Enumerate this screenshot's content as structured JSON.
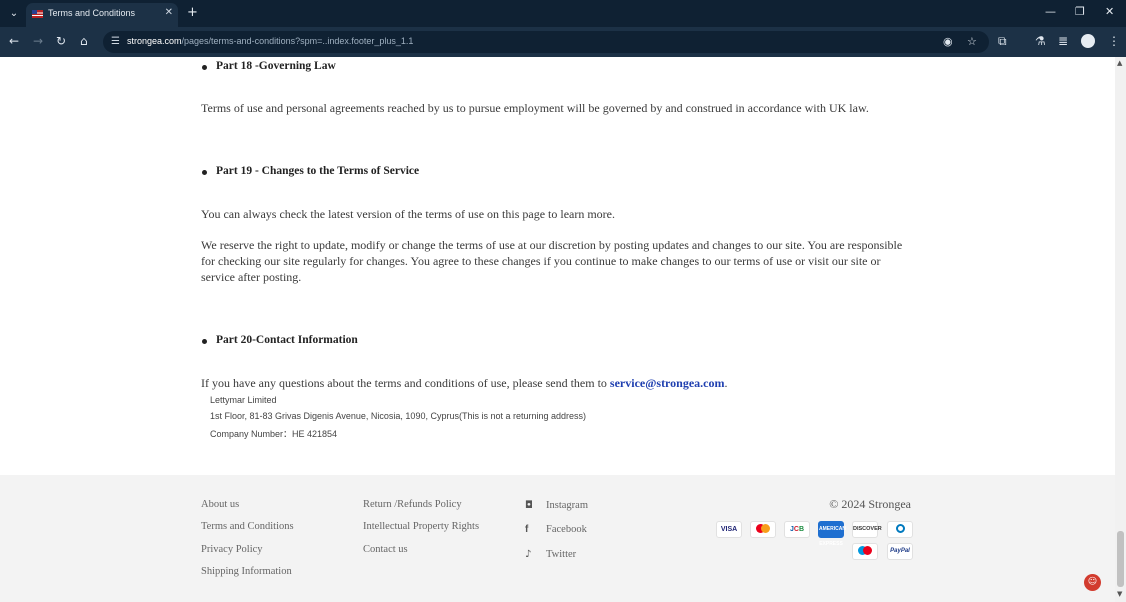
{
  "browser": {
    "tab_title": "Terms and Conditions",
    "url_host": "strongea.com",
    "url_path": "/pages/terms-and-conditions?spm=..index.footer_plus_1.1"
  },
  "content": {
    "part18_heading": "Part 18 -Governing  Law",
    "part18_text": "Terms of use and personal agreements reached by us to pursue employment will be governed by and construed in accordance with UK law.",
    "part19_heading": "Part 19 - Changes to the Terms of Service",
    "part19_text1": "You can always check the latest version of the terms of use on this page to learn more.",
    "part19_text2": "We reserve the right to update, modify or change the terms of use at our discretion by posting updates and changes to our site. You are responsible for checking our site regularly for changes. You agree to these changes if you continue to make changes to our terms of use or visit our site or service after posting.",
    "part20_heading": "Part 20-Contact Information",
    "part20_text": "If you have any questions about the terms and conditions of use, please send them to ",
    "contact_email": "service@strongea.com",
    "contact_email_suffix": ".",
    "company_name": "Lettymar Limited",
    "company_address": "1st Floor, 81-83 Grivas Digenis Avenue, Nicosia, 1090, Cyprus(This is not a returning address)",
    "company_number": "Company Number：HE 421854"
  },
  "footer": {
    "col1": [
      "About us",
      "Terms and Conditions",
      "Privacy Policy",
      "Shipping Information"
    ],
    "col2": [
      "Return /Refunds Policy",
      "Intellectual Property Rights",
      "Contact us"
    ],
    "social": [
      {
        "icon": "instagram-icon",
        "label": "Instagram"
      },
      {
        "icon": "facebook-icon",
        "label": "Facebook"
      },
      {
        "icon": "twitter-icon",
        "label": "Twitter"
      }
    ],
    "copyright": "© 2024 Strongea",
    "payments": {
      "visa": "VISA",
      "amex": "AMERICAN EXPRESS",
      "discover": "DISCOVER",
      "paypal": "PayPal"
    }
  },
  "colors": {
    "link": "#1f3fb0",
    "browser_dark": "#0f2133",
    "browser_toolbar": "#1c3146",
    "footer_bg": "#f3f3f3"
  }
}
